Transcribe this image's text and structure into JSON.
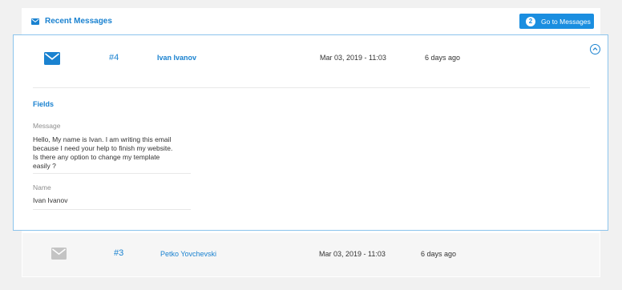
{
  "header": {
    "title": "Recent Messages",
    "icon": "envelope-icon",
    "goto_button": {
      "badge": "2",
      "label": "Go to Messages"
    }
  },
  "messages": [
    {
      "id": "#4",
      "sender": "Ivan Ivanov",
      "date": "Mar 03, 2019 - 11:03",
      "ago": "6 days ago",
      "expanded": true,
      "fields_title": "Fields",
      "fields": [
        {
          "label": "Message",
          "lines": [
            "Hello, My name is Ivan. I am writing this email",
            "because I need your help to finish my website.",
            "Is there any option to change my template",
            "easily ?"
          ]
        },
        {
          "label": "Name",
          "lines": [
            "Ivan Ivanov"
          ]
        }
      ]
    },
    {
      "id": "#3",
      "sender": "Petko Yovchevski",
      "date": "Mar 03, 2019 - 11:03",
      "ago": "6 days ago",
      "expanded": false
    }
  ],
  "colors": {
    "accent": "#1a82d0",
    "button": "#1a8ee0",
    "expanded_border": "#8cc4ec",
    "muted_icon": "#c4c4c4"
  }
}
